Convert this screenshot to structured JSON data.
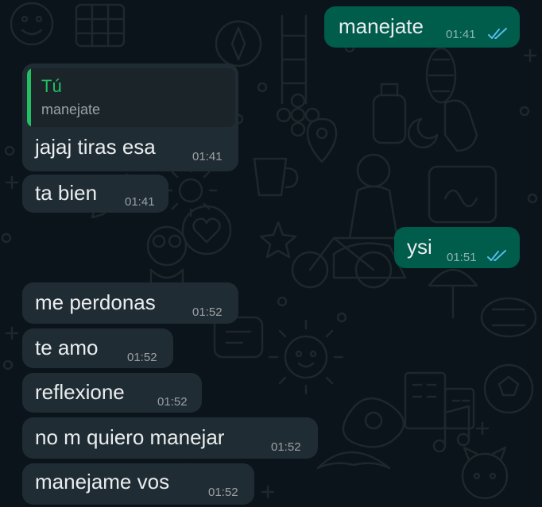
{
  "colors": {
    "background": "#0b141a",
    "incoming_bubble": "#202c33",
    "outgoing_bubble": "#005c4b",
    "reply_accent": "#21c063",
    "read_ticks": "#53bdeb"
  },
  "messages": [
    {
      "direction": "outgoing",
      "text": "manejate",
      "time": "01:41",
      "status": "read-ticks-icon"
    },
    {
      "direction": "incoming",
      "reply_to": {
        "author": "Tú",
        "text": "manejate"
      },
      "text": "jajaj tiras esa",
      "time": "01:41"
    },
    {
      "direction": "incoming",
      "text": "ta bien",
      "time": "01:41"
    },
    {
      "direction": "outgoing",
      "text": "ysi",
      "time": "01:51",
      "status": "read-ticks-icon"
    },
    {
      "direction": "incoming",
      "text": "me perdonas",
      "time": "01:52"
    },
    {
      "direction": "incoming",
      "text": "te amo",
      "time": "01:52"
    },
    {
      "direction": "incoming",
      "text": "reflexione",
      "time": "01:52"
    },
    {
      "direction": "incoming",
      "text": "no m quiero manejar",
      "time": "01:52"
    },
    {
      "direction": "incoming",
      "text": "manejame vos",
      "time": "01:52"
    }
  ]
}
